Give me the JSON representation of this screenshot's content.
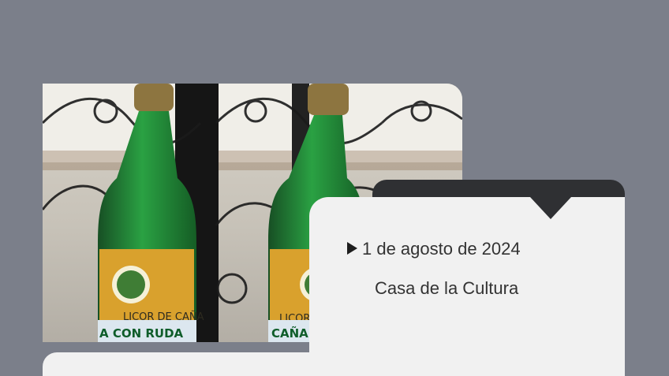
{
  "event": {
    "date": "1 de agosto de 2024",
    "location": "Casa de la Cultura"
  },
  "photo": {
    "label_text": "LICOR DE CAÑA",
    "label_secondary": "CAÑA CON RUDA"
  },
  "colors": {
    "background": "#7b7f8a",
    "panel": "#f1f1f1",
    "dark_tab": "#2f3033",
    "text": "#333333"
  }
}
